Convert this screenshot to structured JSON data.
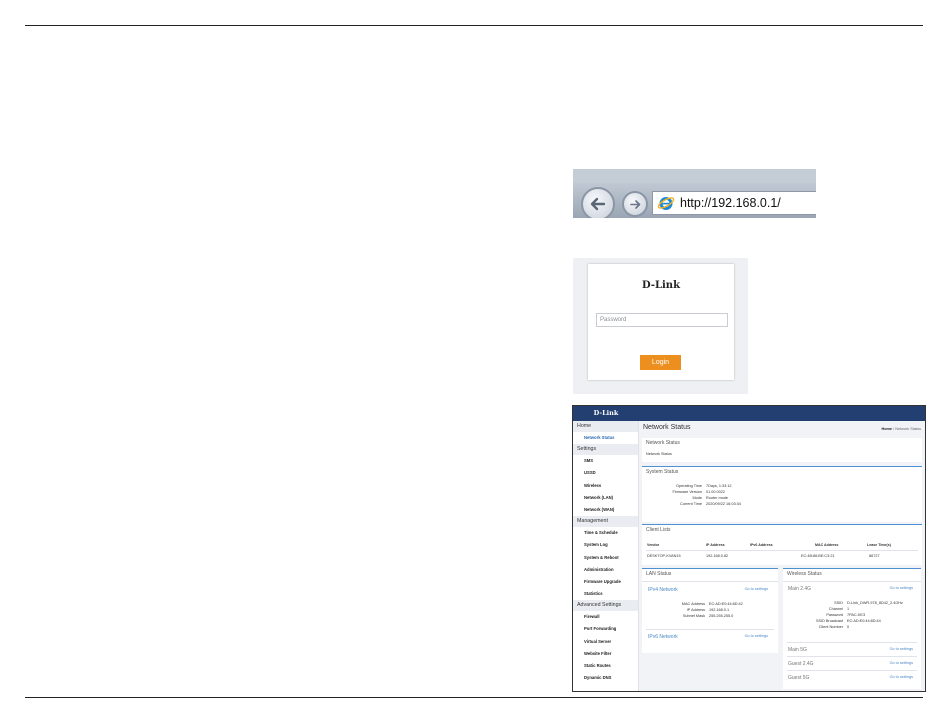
{
  "browser": {
    "url": "http://192.168.0.1/"
  },
  "login": {
    "logo": "D-Link",
    "password_placeholder": "Password",
    "login_label": "Login"
  },
  "router": {
    "logo": "D-Link",
    "sidebar": {
      "home": "Home",
      "network_status": "Network Status",
      "settings": "Settings",
      "settings_items": [
        "SMS",
        "USSD",
        "Wireless",
        "Network (LAN)",
        "Network (WAN)"
      ],
      "management": "Management",
      "management_items": [
        "Time & Schedule",
        "System Log",
        "System & Reboot",
        "Administration",
        "Firmware Upgrade",
        "Statistics"
      ],
      "advanced": "Advanced Settings",
      "advanced_items": [
        "Firewall",
        "Port Forwarding",
        "Virtual Server",
        "Website Filter",
        "Static Routes",
        "Dynamic DNS"
      ]
    },
    "main": {
      "title": "Network Status",
      "breadcrumb_home": "Home",
      "breadcrumb_current": "Network Status",
      "network_status": {
        "title": "Network Status",
        "value": "Network Status"
      },
      "system_status": {
        "title": "System Status",
        "rows": [
          {
            "label": "Operating Time",
            "value": "7Days, 1:33:12"
          },
          {
            "label": "Firmware Version",
            "value": "01.00.0022"
          },
          {
            "label": "Mode",
            "value": "Router mode"
          },
          {
            "label": "Current Time",
            "value": "2020/09/22 16:03:34"
          }
        ]
      },
      "client_lists": {
        "title": "Client Lists",
        "headers": [
          "Vendor",
          "IP Address",
          "IPv6 Address",
          "MAC Address",
          "Lease Time(s)"
        ],
        "rows": [
          [
            "DESKTOP-KVAN15",
            "192.168.0.82",
            "",
            "EC:4B:86:BE:C3:21",
            "86727"
          ]
        ]
      },
      "lan_status": {
        "title": "LAN Status",
        "ipv4": "IPv4 Network",
        "go": "Go to settings",
        "rows": [
          {
            "label": "MAC Address",
            "value": "EC:AD:E0:44:8D:42"
          },
          {
            "label": "IP Address",
            "value": "192.168.0.1"
          },
          {
            "label": "Subnet Mask",
            "value": "255.255.255.0"
          }
        ],
        "ipv6": "IPv6 Network"
      },
      "wireless_status": {
        "title": "Wireless Status",
        "main24": "Main 2.4G",
        "go": "Go to settings",
        "rows": [
          {
            "label": "SSID",
            "value": "D-Link_DWR-978_8D42_2.4GHz"
          },
          {
            "label": "Channel",
            "value": "1"
          },
          {
            "label": "Password",
            "value": "7PAC-KE3"
          },
          {
            "label": "SSID Broadcast",
            "value": "EC:AD:E0:44:8D:44"
          },
          {
            "label": "Client Number",
            "value": "0"
          }
        ],
        "main5": "Main 5G",
        "guest24": "Guest 2.4G",
        "guest5": "Guest 5G"
      }
    }
  }
}
